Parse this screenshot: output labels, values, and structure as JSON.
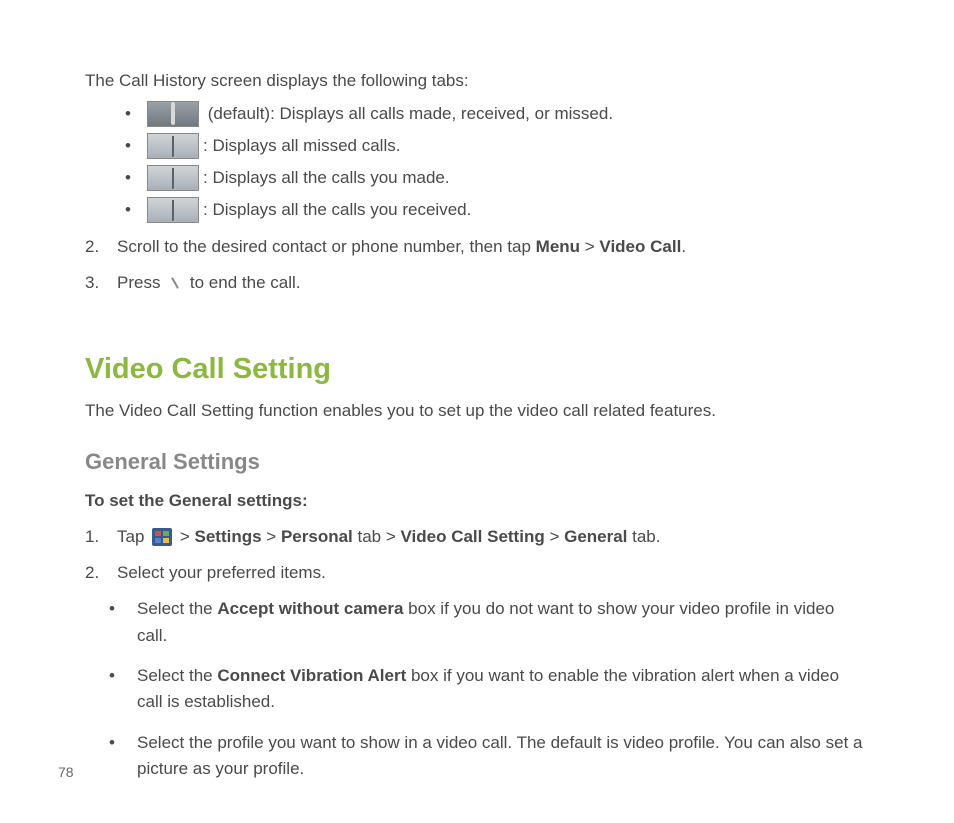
{
  "intro": "The Call History screen displays the following tabs:",
  "tabs": [
    {
      "suffix": " (default): Displays all calls made, received, or missed."
    },
    {
      "suffix": ": Displays all missed calls."
    },
    {
      "suffix": ": Displays all the calls you made."
    },
    {
      "suffix": ": Displays all the calls you received."
    }
  ],
  "step2": {
    "num": "2.",
    "prefix": "Scroll to the desired contact or phone number, then tap ",
    "bold1": "Menu",
    "sep": " > ",
    "bold2": "Video Call",
    "suffix": "."
  },
  "step3": {
    "num": "3.",
    "prefix": "Press ",
    "suffix": " to end the call."
  },
  "heading1": "Video Call Setting",
  "desc": "The Video Call Setting function enables you to set up the video call related features.",
  "heading2": "General Settings",
  "subhead": "To set the General settings:",
  "g1": {
    "num": "1.",
    "prefix": "Tap ",
    "sep1": " > ",
    "bold1": "Settings",
    "bold2": "Personal",
    "tab1": " tab > ",
    "bold3": "Video Call Setting",
    "bold4": "General",
    "tab2": " tab."
  },
  "g2": {
    "num": "2.",
    "text": "Select your preferred items."
  },
  "sub": [
    {
      "prefix": "Select the ",
      "bold": "Accept without camera",
      "suffix": " box if you do not want to show your video profile in video call."
    },
    {
      "prefix": "Select the ",
      "bold": "Connect Vibration Alert",
      "suffix": " box if you want to enable the vibration alert when a video call is established."
    },
    {
      "full": "Select the profile you want to show in a video call. The default is video profile. You can also set a picture as your profile."
    }
  ],
  "pageNum": "78"
}
